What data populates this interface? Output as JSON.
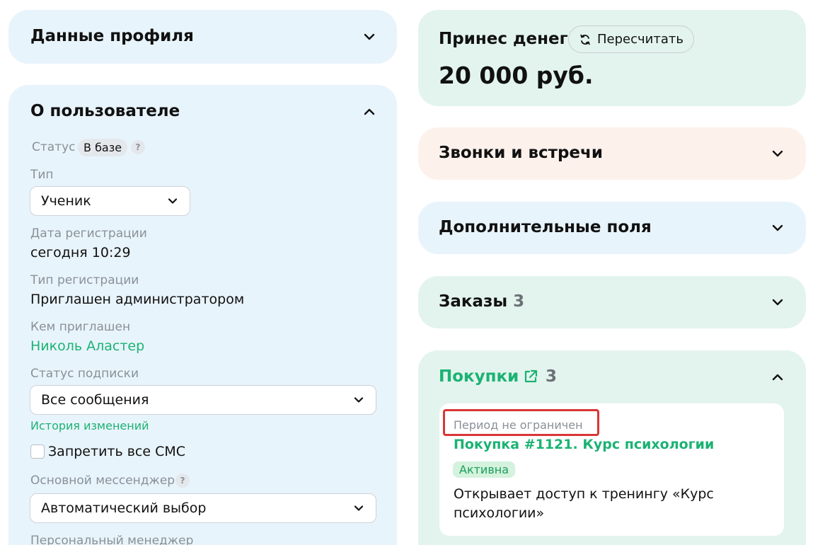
{
  "profile_data": {
    "title": "Данные профиля"
  },
  "about_user": {
    "title": "О пользователе",
    "status_label": "Статус",
    "status_value": "В базе",
    "help": "?",
    "type_label": "Тип",
    "type_value": "Ученик",
    "reg_date_label": "Дата регистрации",
    "reg_date_value": "сегодня 10:29",
    "reg_type_label": "Тип регистрации",
    "reg_type_value": "Приглашен администратором",
    "invited_by_label": "Кем приглашен",
    "invited_by_value": "Николь Аластер",
    "subscription_label": "Статус подписки",
    "subscription_value": "Все сообщения",
    "history_link": "История изменений",
    "block_sms_label": "Запретить все СМС",
    "messenger_label": "Основной мессенджер",
    "messenger_value": "Автоматический выбор",
    "manager_label": "Персональный менеджер"
  },
  "money": {
    "title": "Принес денег",
    "recalc_label": "Пересчитать",
    "amount": "20 000 руб."
  },
  "calls": {
    "title": "Звонки и встречи"
  },
  "extra_fields": {
    "title": "Дополнительные поля"
  },
  "orders": {
    "title": "Заказы",
    "count": "3"
  },
  "purchases": {
    "title": "Покупки",
    "count": "3",
    "item": {
      "period": "Период не ограничен",
      "name": "Покупка #1121. Курс психологии",
      "status": "Активна",
      "description_line1": "Открывает доступ к тренингу «Курс",
      "description_line2": "психологии»"
    }
  },
  "colors": {
    "accent_green": "#1bb273",
    "card_blue": "#e8f4fb",
    "card_green": "#e3f4ee",
    "card_peach": "#fdf1ec",
    "highlight_red": "#d93636"
  }
}
